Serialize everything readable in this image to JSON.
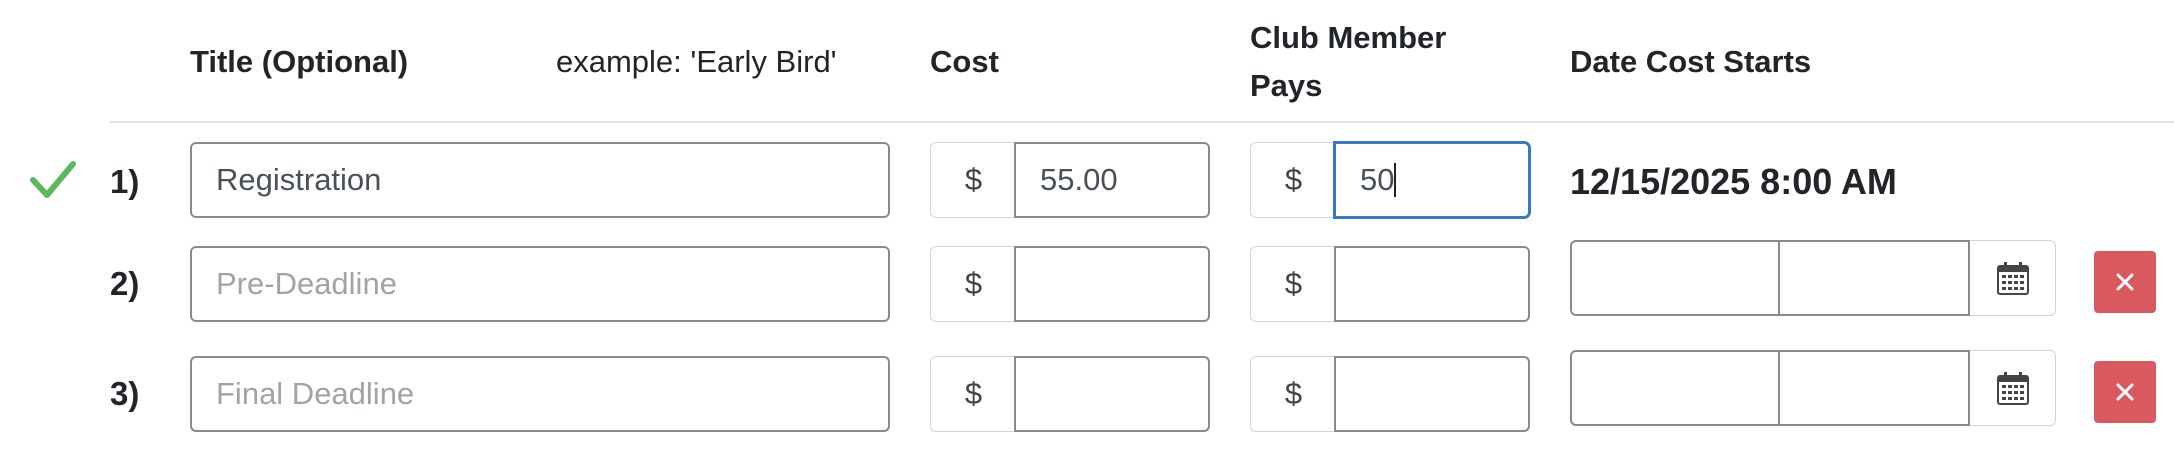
{
  "header": {
    "title_label": "Title (Optional)",
    "example_label": "example: 'Early Bird'",
    "cost_label": "Cost",
    "member_label_line1": "Club Member",
    "member_label_line2": "Pays",
    "date_label": "Date Cost Starts"
  },
  "rows": [
    {
      "number": "1)",
      "status_icon": "check-icon",
      "title_value": "Registration",
      "currency": "$",
      "cost_value": "55.00",
      "member_currency": "$",
      "member_value": "50",
      "date_text": "12/15/2025 8:00 AM"
    },
    {
      "number": "2)",
      "title_placeholder": "Pre-Deadline",
      "currency": "$",
      "cost_value": "",
      "member_currency": "$",
      "member_value": "",
      "date_value": "",
      "time_value": "",
      "calendar_icon": "calendar-icon",
      "delete_icon": "close-icon"
    },
    {
      "number": "3)",
      "title_placeholder": "Final Deadline",
      "currency": "$",
      "cost_value": "",
      "member_currency": "$",
      "member_value": "",
      "date_value": "",
      "time_value": "",
      "calendar_icon": "calendar-icon",
      "delete_icon": "close-icon"
    }
  ],
  "colors": {
    "check": "#5cb85c",
    "delete_button": "#d9595f",
    "focus_border": "#3b78c4"
  }
}
